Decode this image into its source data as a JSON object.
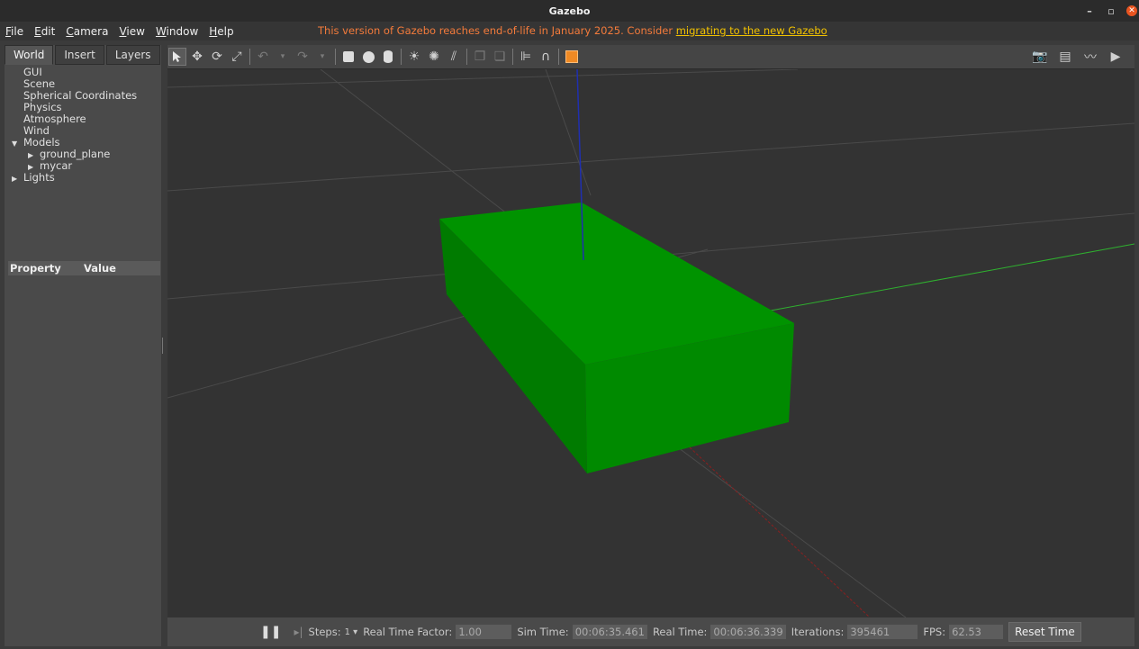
{
  "window": {
    "title": "Gazebo",
    "minimize": "–",
    "maximize": "▫",
    "close": "✕"
  },
  "menu": {
    "items": [
      {
        "u": "F",
        "rest": "ile"
      },
      {
        "u": "E",
        "rest": "dit"
      },
      {
        "u": "C",
        "rest": "amera"
      },
      {
        "u": "V",
        "rest": "iew"
      },
      {
        "u": "W",
        "rest": "indow"
      },
      {
        "u": "H",
        "rest": "elp"
      }
    ],
    "eol_text": "This version of Gazebo reaches end-of-life in January 2025. Consider ",
    "eol_link": "migrating to the new Gazebo"
  },
  "left_panel": {
    "tabs": [
      "World",
      "Insert",
      "Layers"
    ],
    "tree": {
      "gui": "GUI",
      "scene": "Scene",
      "spherical": "Spherical Coordinates",
      "physics": "Physics",
      "atmosphere": "Atmosphere",
      "wind": "Wind",
      "models": "Models",
      "ground_plane": "ground_plane",
      "mycar": "mycar",
      "lights": "Lights"
    },
    "property_header": "Property",
    "value_header": "Value"
  },
  "toolbar": {
    "icons": [
      "select-arrow-icon",
      "translate-icon",
      "rotate-icon",
      "scale-icon",
      "undo-icon",
      "redo-icon",
      "box-icon",
      "sphere-icon",
      "cylinder-icon",
      "point-light-icon",
      "spot-light-icon",
      "directional-light-icon",
      "copy-icon",
      "paste-icon",
      "align-icon",
      "snap-magnet-icon",
      "change-view-icon",
      "screenshot-icon",
      "log-icon",
      "plot-icon",
      "video-icon"
    ]
  },
  "status": {
    "steps_label": "Steps:",
    "steps_value": "1",
    "rtf_label": "Real Time Factor:",
    "rtf_value": "1.00",
    "sim_label": "Sim Time:",
    "sim_value": "00:06:35.461",
    "real_label": "Real Time:",
    "real_value": "00:06:36.339",
    "iter_label": "Iterations:",
    "iter_value": "395461",
    "fps_label": "FPS:",
    "fps_value": "62.53",
    "reset_button": "Reset Time"
  },
  "colors": {
    "model_top": "#009300",
    "model_left": "#007b00",
    "model_front": "#008a00",
    "eol": "#f47b3b",
    "eol_link": "#f2c200"
  }
}
